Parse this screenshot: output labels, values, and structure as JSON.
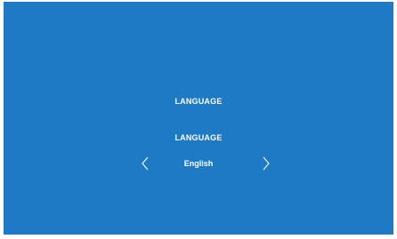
{
  "screen": {
    "title": "LANGUAGE",
    "background_color": "#1e7ac4",
    "text_color": "#ffffff"
  },
  "language_setting": {
    "label": "LANGUAGE",
    "value": "English",
    "prev_icon": "chevron-left-icon",
    "next_icon": "chevron-right-icon"
  }
}
